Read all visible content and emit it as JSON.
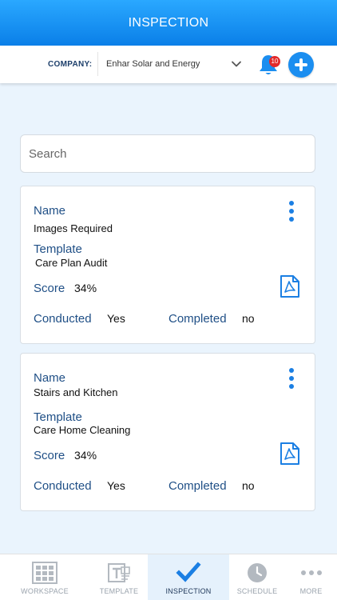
{
  "header": {
    "title": "INSPECTION"
  },
  "company": {
    "label": "COMPANY:",
    "selected": "Enhar Solar and Energy",
    "notifications": "10"
  },
  "search": {
    "placeholder": "Search"
  },
  "labels": {
    "name": "Name",
    "template": "Template",
    "score": "Score",
    "conducted": "Conducted",
    "completed": "Completed"
  },
  "inspections": [
    {
      "name": "Images Required",
      "template": "Care Plan Audit",
      "score": "34%",
      "conducted": "Yes",
      "completed": "no"
    },
    {
      "name": "Stairs and Kitchen",
      "template": "Care Home Cleaning",
      "score": "34%",
      "conducted": "Yes",
      "completed": "no"
    }
  ],
  "nav": [
    {
      "label": "WORKSPACE",
      "icon": "workspace-icon",
      "active": false
    },
    {
      "label": "TEMPLATE",
      "icon": "template-icon",
      "active": false
    },
    {
      "label": "INSPECTION",
      "icon": "checkmark-icon",
      "active": true
    },
    {
      "label": "SCHEDULE",
      "icon": "clock-icon",
      "active": false
    },
    {
      "label": "MORE",
      "icon": "more-icon",
      "active": false
    }
  ],
  "colors": {
    "header": "#0a7fe8",
    "accent": "#1b8ef0",
    "label": "#1f4f86",
    "badge": "#e32a2a"
  }
}
